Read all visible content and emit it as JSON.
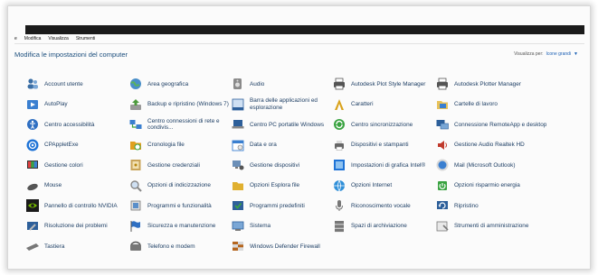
{
  "menu": [
    "e",
    "Modifica",
    "Visualizza",
    "Strumenti"
  ],
  "page_title": "Modifica le impostazioni del computer",
  "view_by": {
    "label": "Visualizza per:",
    "value": "Icone grandi",
    "chevron": "▼"
  },
  "colors": {
    "link": "#1d3e64",
    "title": "#1a4d7c",
    "accent": "#1a5fb4"
  },
  "items": [
    {
      "label": "Account utente",
      "icon": "users-icon",
      "color": "#3a6ea5"
    },
    {
      "label": "Area geografica",
      "icon": "globe-clock-icon",
      "color": "#4a8fc9"
    },
    {
      "label": "Audio",
      "icon": "speaker-icon",
      "color": "#8a8a8a"
    },
    {
      "label": "Autodesk Plot Style Manager",
      "icon": "plot-style-icon",
      "color": "#555555"
    },
    {
      "label": "Autodesk Plotter Manager",
      "icon": "plotter-icon",
      "color": "#555555"
    },
    {
      "label": "AutoPlay",
      "icon": "autoplay-icon",
      "color": "#3a7fd0"
    },
    {
      "label": "Backup e ripristino (Windows 7)",
      "icon": "backup-icon",
      "color": "#4c9a3c"
    },
    {
      "label": "Barra delle applicazioni ed esplorazione",
      "icon": "taskbar-icon",
      "color": "#2d5f9a"
    },
    {
      "label": "Caratteri",
      "icon": "fonts-icon",
      "color": "#d9a21b"
    },
    {
      "label": "Cartelle di lavoro",
      "icon": "work-folders-icon",
      "color": "#3a7fd0"
    },
    {
      "label": "Centro accessibilità",
      "icon": "accessibility-icon",
      "color": "#2f6fc2"
    },
    {
      "label": "Centro connessioni di rete e condivis...",
      "icon": "network-center-icon",
      "color": "#3a7fd0"
    },
    {
      "label": "Centro PC portatile Windows",
      "icon": "mobility-center-icon",
      "color": "#2d5f9a"
    },
    {
      "label": "Centro sincronizzazione",
      "icon": "sync-center-icon",
      "color": "#3aa341"
    },
    {
      "label": "Connessione RemoteApp e desktop",
      "icon": "remoteapp-icon",
      "color": "#2d5f9a"
    },
    {
      "label": "CPAppletExe",
      "icon": "cpapplet-icon",
      "color": "#1e73d6"
    },
    {
      "label": "Cronologia file",
      "icon": "file-history-icon",
      "color": "#e0a020"
    },
    {
      "label": "Data e ora",
      "icon": "date-time-icon",
      "color": "#3a7fd0"
    },
    {
      "label": "Dispositivi e stampanti",
      "icon": "devices-printers-icon",
      "color": "#666666"
    },
    {
      "label": "Gestione Audio Realtek HD",
      "icon": "realtek-audio-icon",
      "color": "#c0392b"
    },
    {
      "label": "Gestione colori",
      "icon": "color-management-icon",
      "color": "#3a7fd0"
    },
    {
      "label": "Gestione credenziali",
      "icon": "credential-manager-icon",
      "color": "#b8860b"
    },
    {
      "label": "Gestione dispositivi",
      "icon": "device-manager-icon",
      "color": "#555555"
    },
    {
      "label": "Impostazioni di grafica Intel®",
      "icon": "intel-graphics-icon",
      "color": "#1e73d6"
    },
    {
      "label": "Mail (Microsoft Outlook)",
      "icon": "mail-icon",
      "color": "#3a7fd0"
    },
    {
      "label": "Mouse",
      "icon": "mouse-icon",
      "color": "#555555"
    },
    {
      "label": "Opzioni di indicizzazione",
      "icon": "indexing-icon",
      "color": "#888888"
    },
    {
      "label": "Opzioni Esplora file",
      "icon": "folder-options-icon",
      "color": "#e0b030"
    },
    {
      "label": "Opzioni Internet",
      "icon": "internet-options-icon",
      "color": "#2f8fd8"
    },
    {
      "label": "Opzioni risparmio energia",
      "icon": "power-options-icon",
      "color": "#3aa341"
    },
    {
      "label": "Pannello di controllo NVIDIA",
      "icon": "nvidia-icon",
      "color": "#76b900"
    },
    {
      "label": "Programmi e funzionalità",
      "icon": "programs-features-icon",
      "color": "#777777"
    },
    {
      "label": "Programmi predefiniti",
      "icon": "default-programs-icon",
      "color": "#3aa341"
    },
    {
      "label": "Riconoscimento vocale",
      "icon": "microphone-icon",
      "color": "#777777"
    },
    {
      "label": "Ripristino",
      "icon": "recovery-icon",
      "color": "#2d5f9a"
    },
    {
      "label": "Risoluzione dei problemi",
      "icon": "troubleshooting-icon",
      "color": "#2d5f9a"
    },
    {
      "label": "Sicurezza e manutenzione",
      "icon": "security-flag-icon",
      "color": "#2f6fc2"
    },
    {
      "label": "Sistema",
      "icon": "system-icon",
      "color": "#2d5f9a"
    },
    {
      "label": "Spazi di archiviazione",
      "icon": "storage-spaces-icon",
      "color": "#777777"
    },
    {
      "label": "Strumenti di amministrazione",
      "icon": "admin-tools-icon",
      "color": "#777777"
    },
    {
      "label": "Tastiera",
      "icon": "keyboard-icon",
      "color": "#777777"
    },
    {
      "label": "Telefono e modem",
      "icon": "phone-modem-icon",
      "color": "#777777"
    },
    {
      "label": "Windows Defender Firewall",
      "icon": "firewall-icon",
      "color": "#b5651d"
    }
  ]
}
